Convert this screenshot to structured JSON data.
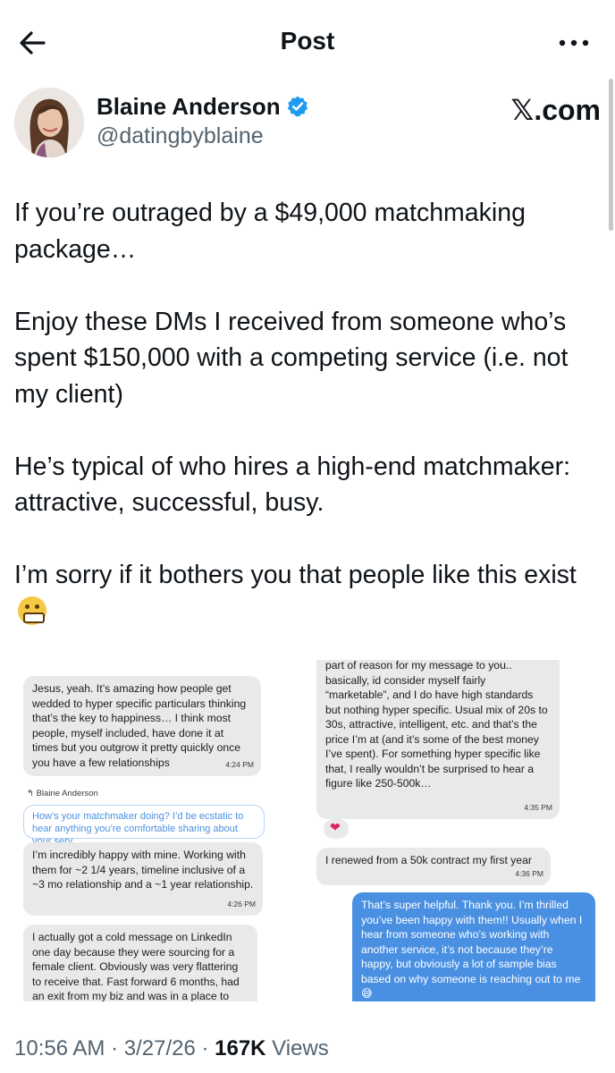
{
  "header": {
    "title": "Post",
    "back_icon": "arrow-left-icon",
    "more_icon": "more-horizontal-icon"
  },
  "author": {
    "name": "Blaine Anderson",
    "handle": "@datingbyblaine",
    "verified": true,
    "source": "𝕏.com",
    "accent_color": "#1d9bf0"
  },
  "tweet": {
    "paragraphs": [
      "If you’re outraged by a $49,000 matchmaking package…",
      "Enjoy these DMs I received from someone who’s spent $150,000 with a competing service (i.e. not my client)",
      "He’s typical of who hires a high-end matchmaker: attractive, successful, busy.",
      "I’m sorry if it bothers you that people like this exist"
    ],
    "emoji": "grimacing-face"
  },
  "screenshots": {
    "left": {
      "msg1": {
        "text": "Jesus, yeah. It’s amazing how people get wedded to hyper specific particulars thinking that’s the key to happiness… I think most people, myself included, have done it at times but you outgrow it pretty quickly once you have a few relationships",
        "time": "4:24 PM"
      },
      "reply_label": "↰ Blaine Anderson",
      "reply_quote": "How’s your matchmaker doing? I’d be ecstatic to hear anything you’re comfortable sharing about your serv…",
      "msg2": {
        "text": "I’m incredibly happy with mine. Working with them for ~2 1/4 years, timeline inclusive of a ~3 mo relationship and a ~1 year relationship.",
        "time": "4:26 PM"
      },
      "msg3": {
        "text": "I actually got a cold message on LinkedIn one day because they were sourcing for a female client. Obviously was very flattering to receive that. Fast forward 6 months, had an exit from my biz and was in a place to"
      }
    },
    "right": {
      "msg1": {
        "text": "part of reason for my message to you.. basically, id consider myself fairly “marketable”, and I do have high standards but nothing hyper specific. Usual mix of 20s to 30s, attractive, intelligent, etc. and that’s the price I’m at (and it’s some of the best money I’ve spent). For something hyper specific like that, I really wouldn’t be surprised to hear a figure like 250-500k…",
        "time": "4:35 PM"
      },
      "reaction": "heart",
      "msg2": {
        "text": "I renewed from a 50k contract my first year",
        "time": "4:36 PM"
      },
      "msg3": {
        "text": "That’s super helpful. Thank you. I’m thrilled you’ve been happy with them!! Usually when I hear from someone who’s working with another service, it’s not because they’re happy, but obviously a lot of sample bias based on why someone is reaching out to me 😅"
      }
    }
  },
  "meta": {
    "time": "10:56 AM",
    "sep1": " · ",
    "date": "3/27/26",
    "sep2": " · ",
    "views_count": "167K",
    "views_label": " Views"
  }
}
